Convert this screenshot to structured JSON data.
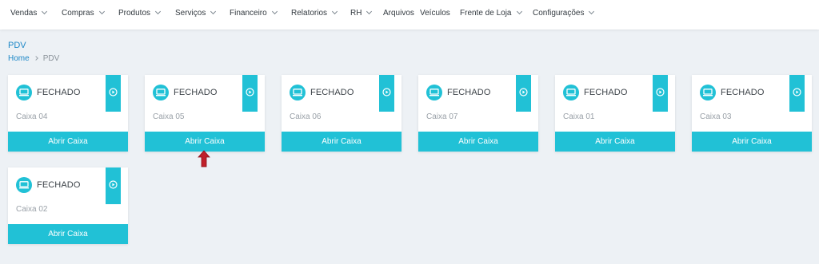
{
  "nav": {
    "items": [
      {
        "label": "Vendas",
        "dropdown": true
      },
      {
        "label": "Compras",
        "dropdown": true
      },
      {
        "label": "Produtos",
        "dropdown": true
      },
      {
        "label": "Serviços",
        "dropdown": true
      },
      {
        "label": "Financeiro",
        "dropdown": true
      },
      {
        "label": "Relatorios",
        "dropdown": true
      },
      {
        "label": "RH",
        "dropdown": true
      },
      {
        "label": "Arquivos",
        "dropdown": false
      },
      {
        "label": "Veículos",
        "dropdown": false
      },
      {
        "label": "Frente de Loja",
        "dropdown": true
      },
      {
        "label": "Configurações",
        "dropdown": true
      }
    ]
  },
  "page": {
    "title": "PDV",
    "breadcrumb": {
      "home": "Home",
      "current": "PDV"
    }
  },
  "cards": [
    {
      "status": "FECHADO",
      "name": "Caixa 04",
      "button": "Abrir Caixa"
    },
    {
      "status": "FECHADO",
      "name": "Caixa 05",
      "button": "Abrir Caixa"
    },
    {
      "status": "FECHADO",
      "name": "Caixa 06",
      "button": "Abrir Caixa"
    },
    {
      "status": "FECHADO",
      "name": "Caixa 07",
      "button": "Abrir Caixa"
    },
    {
      "status": "FECHADO",
      "name": "Caixa 01",
      "button": "Abrir Caixa"
    },
    {
      "status": "FECHADO",
      "name": "Caixa 03",
      "button": "Abrir Caixa"
    },
    {
      "status": "FECHADO",
      "name": "Caixa 02",
      "button": "Abrir Caixa"
    }
  ],
  "colors": {
    "accent": "#21c1d6",
    "link": "#1e88c7",
    "background": "#edf1f5",
    "pointer": "#c0202a"
  },
  "icons": {
    "status": "monitor-icon",
    "play": "play-circle-icon",
    "dropdown": "chevron-down-icon",
    "breadcrumb_separator": "chevron-right-icon",
    "pointer": "red-arrow-up-icon"
  }
}
